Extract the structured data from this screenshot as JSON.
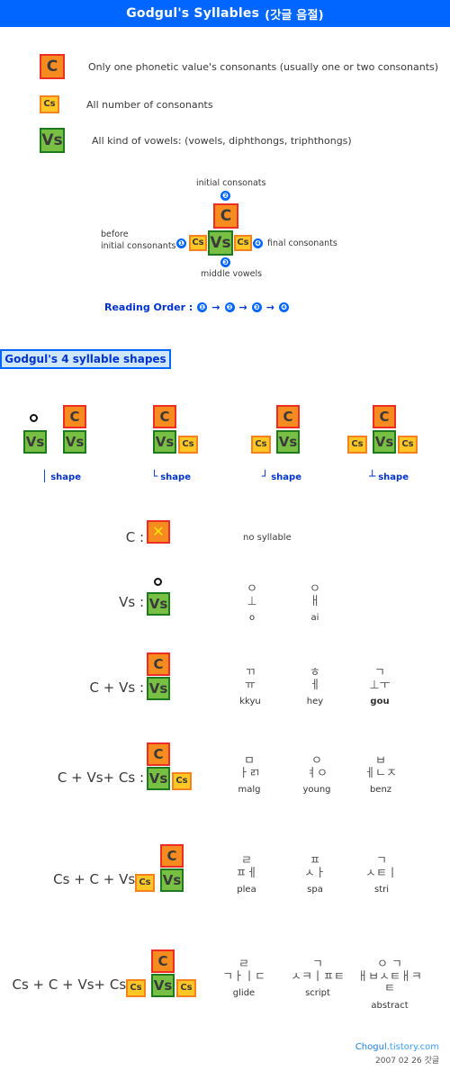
{
  "header": {
    "title_en": "Godgul's Syllables",
    "title_kr": "(갓글 음절)"
  },
  "legend": [
    {
      "box": "C",
      "text": "Only one phonetic value's consonants (usually one or two consonants)"
    },
    {
      "box": "Cs",
      "text": "All number of consonants"
    },
    {
      "box": "Vs",
      "text": "All kind of vowels:  (vowels, diphthongs, triphthongs)"
    }
  ],
  "diagram": {
    "top_label": "initial consonats",
    "bottom_label": "middle vowels",
    "left_label_line1": "before",
    "left_label_line2": "initial consonants",
    "right_label": "final consonants",
    "num1": "❶",
    "num2": "❷",
    "num3": "❸",
    "num4": "❹",
    "box_top": "C",
    "box_left": "Cs",
    "box_center": "Vs",
    "box_right": "Cs"
  },
  "reading_order": {
    "label": "Reading Order :",
    "steps": [
      "❶",
      "❷",
      "❸",
      "❹"
    ],
    "arrow": "→"
  },
  "shapes_section": {
    "heading": "Godgul's 4 syllable shapes",
    "shapes": [
      {
        "glyph": "│",
        "caption": "shape",
        "boxes": "circle + Vs , C over Vs"
      },
      {
        "glyph": "└",
        "caption": "shape",
        "boxes": "C over Vs + Cs right"
      },
      {
        "glyph": "┘",
        "caption": "shape",
        "boxes": "Cs left + C over Vs"
      },
      {
        "glyph": "┴",
        "caption": "shape",
        "boxes": "Cs left + C over Vs + Cs right"
      }
    ]
  },
  "table_rows": [
    {
      "label": "C :",
      "note": "no syllable",
      "examples": []
    },
    {
      "label": "Vs :",
      "note": "",
      "examples": [
        {
          "jamo": "ㅇ\n⊥",
          "rom": "o",
          "bold": false
        },
        {
          "jamo": "ㅇ\nㅐ",
          "rom": "ai",
          "bold": false
        }
      ]
    },
    {
      "label": "C + Vs :",
      "note": "",
      "examples": [
        {
          "jamo": "ㄲ\nㅠ",
          "rom": "kkyu",
          "bold": false
        },
        {
          "jamo": "ㅎ\nㅔ",
          "rom": "hey",
          "bold": false
        },
        {
          "jamo": "ㄱ\n⊥ㅜ",
          "rom": "gou",
          "bold": true
        }
      ]
    },
    {
      "label": "C + Vs+ Cs :",
      "note": "",
      "examples": [
        {
          "jamo": "ㅁ\nㅏㄺ",
          "rom": "malg",
          "bold": false
        },
        {
          "jamo": "ㅇ\nㅕㅇ",
          "rom": "young",
          "bold": false
        },
        {
          "jamo": "ㅂ\nㅔㄴㅈ",
          "rom": "benz",
          "bold": false
        }
      ]
    },
    {
      "label": "Cs + C + Vs :",
      "note": "",
      "examples": [
        {
          "jamo": "ㄹ\nㅍㅔ",
          "rom": "plea",
          "bold": false
        },
        {
          "jamo": "ㅍ\nㅅㅏ",
          "rom": "spa",
          "bold": false
        },
        {
          "jamo": "ㄱ\nㅅㅌㅣ",
          "rom": "stri",
          "bold": false
        }
      ]
    },
    {
      "label": "Cs + C + Vs+ Cs :",
      "note": "",
      "examples": [
        {
          "jamo": "ㄹ\nㄱㅏㅣㄷ",
          "rom": "glide",
          "bold": false
        },
        {
          "jamo": "ㄱ\nㅅㅋㅣㅍㅌ",
          "rom": "script",
          "bold": false
        },
        {
          "jamo": "ㅇ  ㄱ\nㅐㅂㅅㅌㅐㅋㅌ",
          "rom": "abstract",
          "bold": false
        }
      ]
    }
  ],
  "footer": {
    "site_prefix": "Chogul.",
    "site_suffix": "tistory.com",
    "date": "2007 02 26",
    "kr": "갓글"
  },
  "colors": {
    "title_bar": "#0066ff",
    "consonant_fill": "#f68b1f",
    "consonant_border": "#ee2d24",
    "consonant_set_fill": "#ffc725",
    "consonant_set_border": "#f58220",
    "vowel_fill": "#78c043",
    "vowel_border": "#1f7a1f",
    "accent_blue": "#0033cc",
    "heading_bg": "#cfe6ff",
    "link": "#3aa0ff"
  }
}
